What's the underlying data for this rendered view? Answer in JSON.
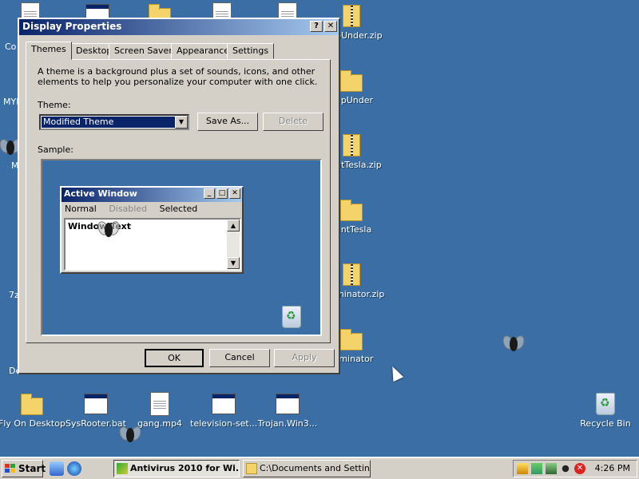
{
  "desktop": {
    "right_icons": [
      {
        "label": "pUnder.zip",
        "kind": "zip"
      },
      {
        "label": "epUnder",
        "kind": "folder"
      },
      {
        "label": "ntTesla.zip",
        "kind": "zip"
      },
      {
        "label": "entTesla",
        "kind": "folder"
      },
      {
        "label": "minator.zip",
        "kind": "zip"
      },
      {
        "label": "rminator",
        "kind": "folder"
      }
    ],
    "left_fragments": [
      "Co",
      "MYP",
      "M",
      "7z",
      "De"
    ],
    "bottom_icons": [
      {
        "label": "Fly On Desktop",
        "kind": "folder"
      },
      {
        "label": "SysRooter.bat",
        "kind": "gear"
      },
      {
        "label": "gang.mp4",
        "kind": "doc"
      },
      {
        "label": "television-set...",
        "kind": "winapp"
      },
      {
        "label": "Trojan.Win3...",
        "kind": "winapp"
      }
    ],
    "recycle_bin": "Recycle Bin"
  },
  "dialog": {
    "title": "Display Properties",
    "help_btn": "?",
    "close_btn": "✕",
    "tabs": [
      "Themes",
      "Desktop",
      "Screen Saver",
      "Appearance",
      "Settings"
    ],
    "active_tab": "Themes",
    "description": "A theme is a background plus a set of sounds, icons, and other elements to help you personalize your computer with one click.",
    "theme_label": "Theme:",
    "theme_value": "Modified Theme",
    "save_as": "Save As...",
    "delete": "Delete",
    "sample_label": "Sample:",
    "sample_window": {
      "title": "Active Window",
      "menu": [
        "Normal",
        "Disabled",
        "Selected"
      ],
      "text": "Window Text"
    },
    "ok": "OK",
    "cancel": "Cancel",
    "apply": "Apply"
  },
  "taskbar": {
    "start": "Start",
    "items": [
      {
        "label": "Antivirus 2010 for Wi...",
        "active": true
      },
      {
        "label": "C:\\Documents and Settin...",
        "active": false
      }
    ],
    "clock": "4:26 PM"
  }
}
